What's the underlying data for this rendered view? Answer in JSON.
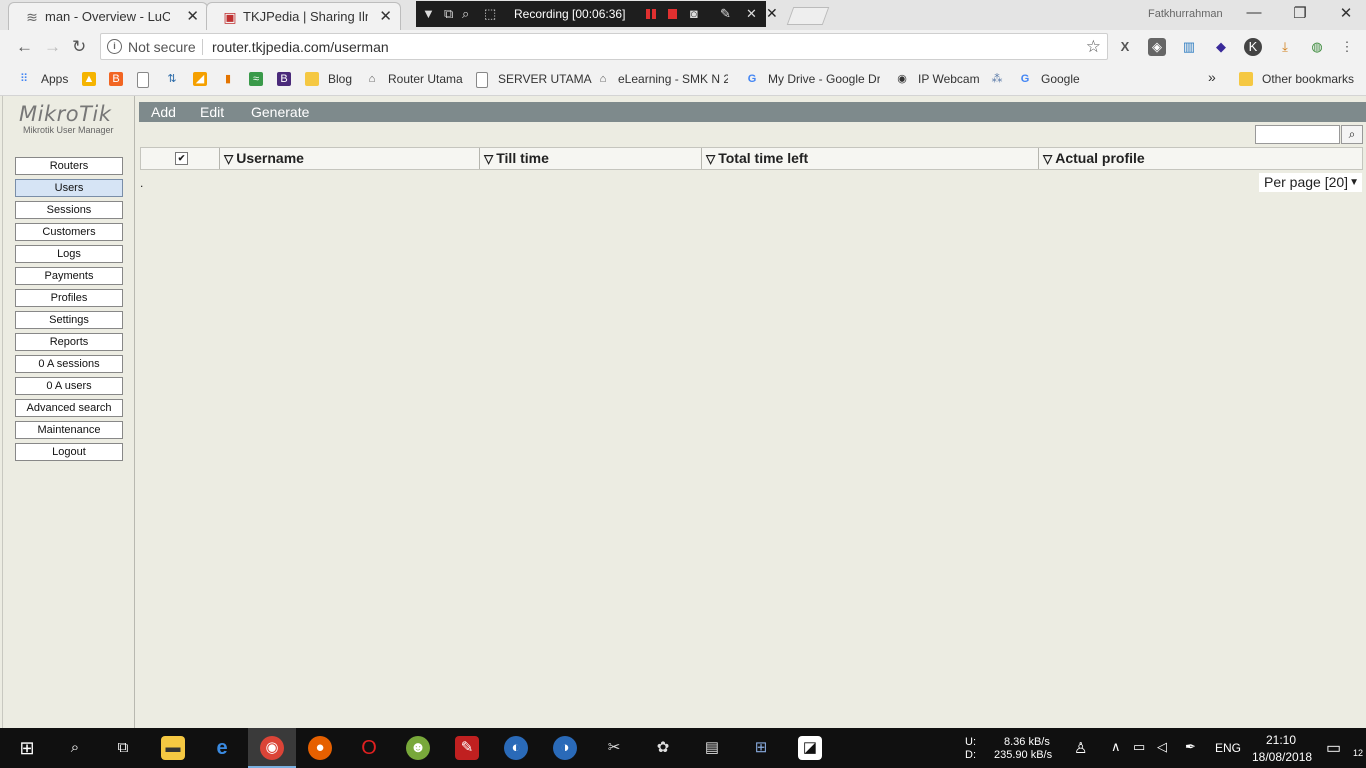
{
  "browser": {
    "tabs": [
      {
        "title": "man - Overview - LuCI"
      },
      {
        "title": "TKJPedia | Sharing Ilmu T"
      }
    ],
    "recording_label": "Recording [00:06:36]",
    "profile_name": "Fatkhurrahman",
    "not_secure": "Not secure",
    "url": "router.tkjpedia.com/userman",
    "bookmarks": [
      {
        "label": "Apps"
      },
      {
        "label": "Blog"
      },
      {
        "label": "Router Utama"
      },
      {
        "label": "SERVER UTAMA"
      },
      {
        "label": "eLearning - SMK N 2"
      },
      {
        "label": "My Drive - Google Dr"
      },
      {
        "label": "IP Webcam"
      },
      {
        "label": "Google"
      },
      {
        "label": "Other bookmarks"
      }
    ],
    "overflow": "»"
  },
  "app": {
    "logo": "MikroTik",
    "subtitle": "Mikrotik User Manager",
    "menu": [
      {
        "label": "Routers"
      },
      {
        "label": "Users",
        "active": true
      },
      {
        "label": "Sessions"
      },
      {
        "label": "Customers"
      },
      {
        "label": "Logs"
      },
      {
        "label": "Payments"
      },
      {
        "label": "Profiles"
      },
      {
        "label": "Settings"
      },
      {
        "label": "Reports"
      },
      {
        "label": "0 A sessions"
      },
      {
        "label": "0 A users"
      },
      {
        "label": "Advanced search"
      },
      {
        "label": "Maintenance"
      },
      {
        "label": "Logout"
      }
    ],
    "actions": {
      "add": "Add",
      "edit": "Edit",
      "generate": "Generate"
    },
    "table": {
      "columns": [
        "Username",
        "Till time",
        "Total time left",
        "Actual profile"
      ],
      "rows": [],
      "empty_marker": "."
    },
    "per_page": "Per page [20]"
  },
  "taskbar": {
    "upload": "8.36 kB/s",
    "download": "235.90 kB/s",
    "upload_label": "U:",
    "download_label": "D:",
    "language": "ENG",
    "time": "21:10",
    "date": "18/08/2018",
    "notifications": "12"
  },
  "colors": {
    "accent": "#7E8A8C",
    "page_bg": "#ECECE2",
    "active_menu": "#D6E4F5"
  }
}
